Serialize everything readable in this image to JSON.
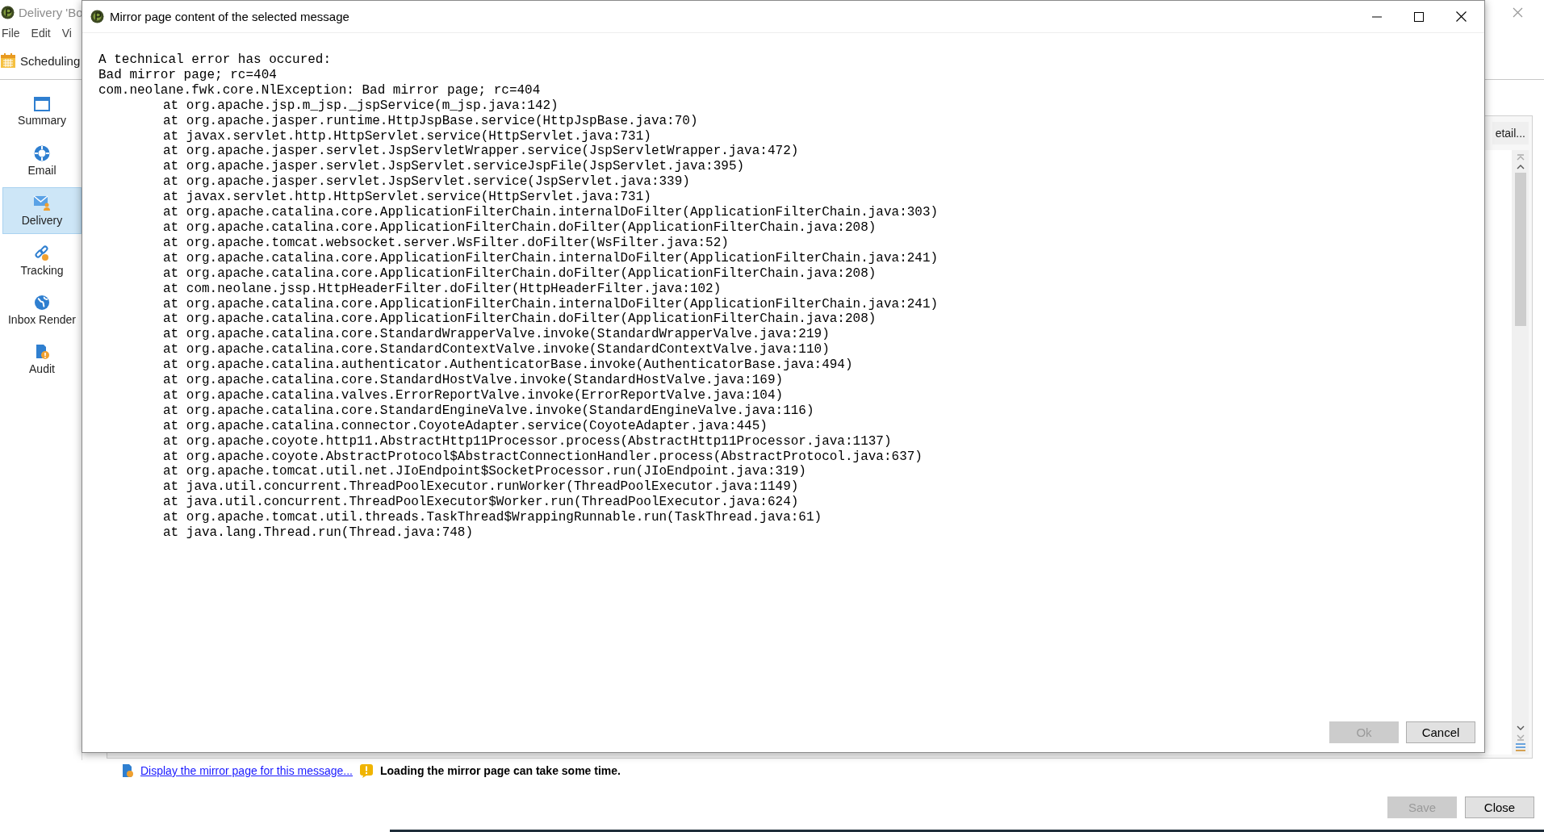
{
  "background_window": {
    "title": "Delivery 'Bo",
    "menu": [
      "File",
      "Edit",
      "Vi"
    ],
    "toolbar_tab": "Scheduling",
    "sidebar": {
      "items": [
        {
          "kind": "summary",
          "label": "Summary",
          "selected": false
        },
        {
          "kind": "email",
          "label": "Email",
          "selected": false
        },
        {
          "kind": "delivery",
          "label": "Delivery",
          "selected": true
        },
        {
          "kind": "tracking",
          "label": "Tracking",
          "selected": false
        },
        {
          "kind": "inbox_rendering",
          "label": "Inbox Render",
          "selected": false
        },
        {
          "kind": "audit",
          "label": "Audit",
          "selected": false
        }
      ]
    },
    "detail_button": "etail...",
    "link": "Display the mirror page for this message...",
    "warning": "Loading the mirror page can take some time.",
    "buttons": [
      {
        "label": "Save",
        "disabled": true
      },
      {
        "label": "Close",
        "disabled": false
      }
    ]
  },
  "dialog": {
    "title": "Mirror page content of the selected message",
    "lines": [
      {
        "kind": "message",
        "text": "A technical error has occured:"
      },
      {
        "kind": "message",
        "text": "Bad mirror page; rc=404"
      },
      {
        "kind": "message",
        "text": "com.neolane.fwk.core.NlException: Bad mirror page; rc=404"
      },
      {
        "kind": "frame",
        "text": "at org.apache.jsp.m_jsp._jspService(m_jsp.java:142)"
      },
      {
        "kind": "frame",
        "text": "at org.apache.jasper.runtime.HttpJspBase.service(HttpJspBase.java:70)"
      },
      {
        "kind": "frame",
        "text": "at javax.servlet.http.HttpServlet.service(HttpServlet.java:731)"
      },
      {
        "kind": "frame",
        "text": "at org.apache.jasper.servlet.JspServletWrapper.service(JspServletWrapper.java:472)"
      },
      {
        "kind": "frame",
        "text": "at org.apache.jasper.servlet.JspServlet.serviceJspFile(JspServlet.java:395)"
      },
      {
        "kind": "frame",
        "text": "at org.apache.jasper.servlet.JspServlet.service(JspServlet.java:339)"
      },
      {
        "kind": "frame",
        "text": "at javax.servlet.http.HttpServlet.service(HttpServlet.java:731)"
      },
      {
        "kind": "frame",
        "text": "at org.apache.catalina.core.ApplicationFilterChain.internalDoFilter(ApplicationFilterChain.java:303)"
      },
      {
        "kind": "frame",
        "text": "at org.apache.catalina.core.ApplicationFilterChain.doFilter(ApplicationFilterChain.java:208)"
      },
      {
        "kind": "frame",
        "text": "at org.apache.tomcat.websocket.server.WsFilter.doFilter(WsFilter.java:52)"
      },
      {
        "kind": "frame",
        "text": "at org.apache.catalina.core.ApplicationFilterChain.internalDoFilter(ApplicationFilterChain.java:241)"
      },
      {
        "kind": "frame",
        "text": "at org.apache.catalina.core.ApplicationFilterChain.doFilter(ApplicationFilterChain.java:208)"
      },
      {
        "kind": "frame",
        "text": "at com.neolane.jssp.HttpHeaderFilter.doFilter(HttpHeaderFilter.java:102)"
      },
      {
        "kind": "frame",
        "text": "at org.apache.catalina.core.ApplicationFilterChain.internalDoFilter(ApplicationFilterChain.java:241)"
      },
      {
        "kind": "frame",
        "text": "at org.apache.catalina.core.ApplicationFilterChain.doFilter(ApplicationFilterChain.java:208)"
      },
      {
        "kind": "frame",
        "text": "at org.apache.catalina.core.StandardWrapperValve.invoke(StandardWrapperValve.java:219)"
      },
      {
        "kind": "frame",
        "text": "at org.apache.catalina.core.StandardContextValve.invoke(StandardContextValve.java:110)"
      },
      {
        "kind": "frame",
        "text": "at org.apache.catalina.authenticator.AuthenticatorBase.invoke(AuthenticatorBase.java:494)"
      },
      {
        "kind": "frame",
        "text": "at org.apache.catalina.core.StandardHostValve.invoke(StandardHostValve.java:169)"
      },
      {
        "kind": "frame",
        "text": "at org.apache.catalina.valves.ErrorReportValve.invoke(ErrorReportValve.java:104)"
      },
      {
        "kind": "frame",
        "text": "at org.apache.catalina.core.StandardEngineValve.invoke(StandardEngineValve.java:116)"
      },
      {
        "kind": "frame",
        "text": "at org.apache.catalina.connector.CoyoteAdapter.service(CoyoteAdapter.java:445)"
      },
      {
        "kind": "frame",
        "text": "at org.apache.coyote.http11.AbstractHttp11Processor.process(AbstractHttp11Processor.java:1137)"
      },
      {
        "kind": "frame",
        "text": "at org.apache.coyote.AbstractProtocol$AbstractConnectionHandler.process(AbstractProtocol.java:637)"
      },
      {
        "kind": "frame",
        "text": "at org.apache.tomcat.util.net.JIoEndpoint$SocketProcessor.run(JIoEndpoint.java:319)"
      },
      {
        "kind": "frame",
        "text": "at java.util.concurrent.ThreadPoolExecutor.runWorker(ThreadPoolExecutor.java:1149)"
      },
      {
        "kind": "frame",
        "text": "at java.util.concurrent.ThreadPoolExecutor$Worker.run(ThreadPoolExecutor.java:624)"
      },
      {
        "kind": "frame",
        "text": "at org.apache.tomcat.util.threads.TaskThread$WrappingRunnable.run(TaskThread.java:61)"
      },
      {
        "kind": "frame",
        "text": "at java.lang.Thread.run(Thread.java:748)"
      }
    ],
    "buttons": [
      {
        "label": "Ok",
        "disabled": true
      },
      {
        "label": "Cancel",
        "disabled": false
      }
    ]
  }
}
